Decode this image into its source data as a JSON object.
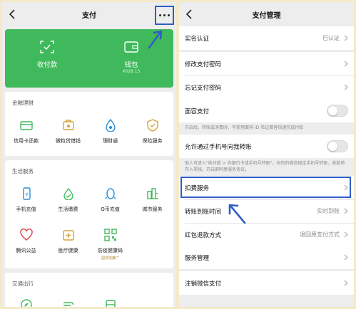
{
  "left_screen": {
    "title": "支付",
    "back_icon": "chevron-left-icon",
    "more_icon": "more-dots-icon",
    "wallet_card": {
      "bg_color": "#3fb95b",
      "items": [
        {
          "label": "收付款",
          "icon": "scan-qr-icon"
        },
        {
          "label": "钱包",
          "sub": "¥628.15",
          "icon": "wallet-icon"
        }
      ]
    },
    "sections": [
      {
        "title": "金融理财",
        "items": [
          {
            "label": "信用卡还款",
            "icon": "credit-card-icon"
          },
          {
            "label": "微粒贷借钱",
            "icon": "loan-icon"
          },
          {
            "label": "理财通",
            "icon": "wealth-icon"
          },
          {
            "label": "保险服务",
            "icon": "insurance-icon"
          }
        ]
      },
      {
        "title": "生活服务",
        "items": [
          {
            "label": "手机充值",
            "icon": "phone-icon"
          },
          {
            "label": "生活缴费",
            "icon": "utility-icon"
          },
          {
            "label": "Q币充值",
            "icon": "penguin-icon"
          },
          {
            "label": "城市服务",
            "icon": "city-icon"
          },
          {
            "label": "腾讯公益",
            "icon": "heart-icon"
          },
          {
            "label": "医疗健康",
            "icon": "medical-icon"
          },
          {
            "label": "防疫健康码",
            "sub": "国务院推广",
            "icon": "qr-code-icon"
          }
        ]
      },
      {
        "title": "交通出行",
        "items": [
          {
            "label": "",
            "icon": "compass-icon"
          },
          {
            "label": "",
            "icon": "train-icon"
          },
          {
            "label": "",
            "icon": "car-icon"
          }
        ]
      }
    ]
  },
  "right_screen": {
    "title": "支付管理",
    "back_icon": "chevron-left-icon",
    "rows": {
      "real_name": {
        "label": "实名认证",
        "value": "已认证"
      },
      "change_pwd": {
        "label": "修改支付密码"
      },
      "forgot_pwd": {
        "label": "忘记支付密码"
      },
      "face_pay": {
        "label": "面容支付",
        "desc": "开启后，转账或消费时，可使用面容 ID 验证面容快速完成付款",
        "enabled": false
      },
      "phone_transfer": {
        "label": "允许通过手机号向我转账",
        "desc": "他人可进入\"收付款 > 向银行卡或手机号转账\"，向你的微信绑定手机号转账，收款将存入零钱。开启即同意服务协议。",
        "enabled": false
      },
      "deduction": {
        "label": "扣费服务"
      },
      "transfer_time": {
        "label": "转账到账时间",
        "value": "实时到账"
      },
      "red_packet_refund": {
        "label": "红包退款方式",
        "value": "退回原支付方式"
      },
      "service_mgmt": {
        "label": "服务管理"
      },
      "cancel_wechat_pay": {
        "label": "注销微信支付"
      }
    }
  },
  "annotation_color": "#2f5ec4"
}
